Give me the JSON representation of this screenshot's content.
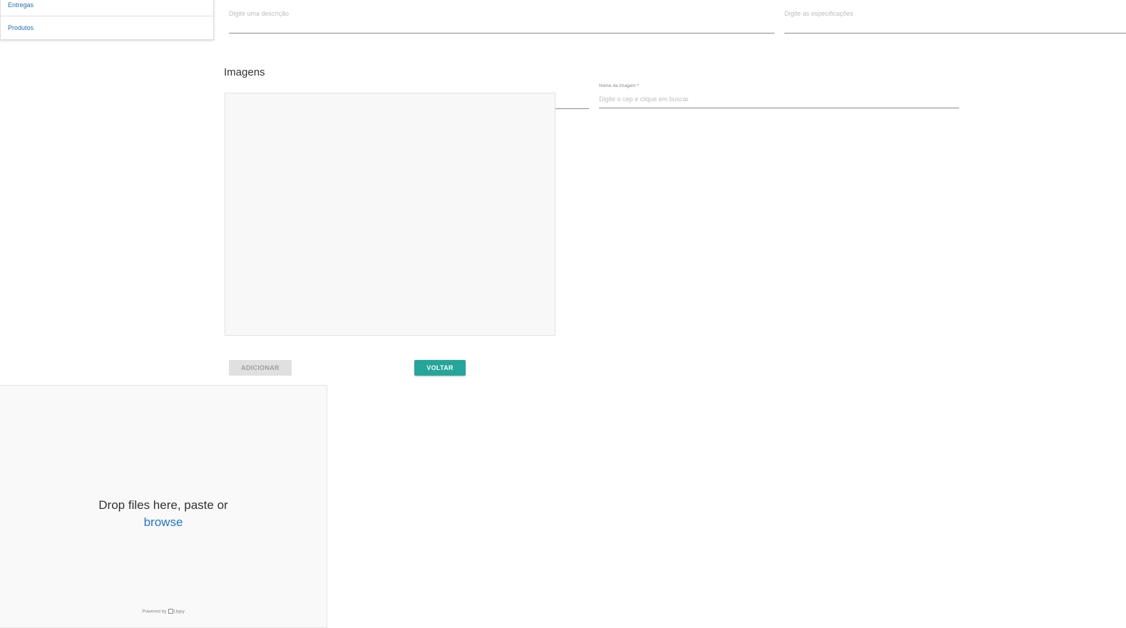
{
  "sidebar": {
    "items": [
      {
        "label": "Entregas"
      },
      {
        "label": "Produtos"
      }
    ]
  },
  "form": {
    "description_placeholder": "Digite uma descrição",
    "specs_placeholder": "Digite as especificações"
  },
  "images_section": {
    "title": "Imagens",
    "image_name_label": "Nome da Imagem *",
    "image_name_placeholder": "Digite o cep e clique em buscar"
  },
  "buttons": {
    "add_label": "ADICIONAR",
    "back_label": "VOLTAR"
  },
  "uploader": {
    "drop_text": "Drop files here, paste or",
    "browse_label": "browse",
    "powered_by": "Powered by",
    "brand": "Uppy"
  },
  "colors": {
    "accent": "#26a69a",
    "link": "#1a73c9",
    "browse_link": "#2275d7",
    "disabled_button": "#e0e0e0"
  }
}
